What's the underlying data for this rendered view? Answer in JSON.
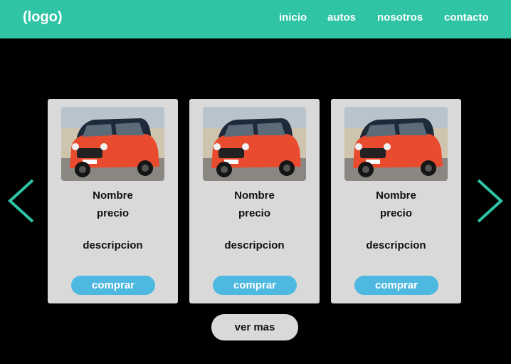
{
  "header": {
    "logo": "(logo)",
    "nav": [
      "inicio",
      "autos",
      "nosotros",
      "contacto"
    ]
  },
  "carousel": {
    "prev_icon": "chevron-left-icon",
    "next_icon": "chevron-right-icon",
    "cards": [
      {
        "image": "red-car-photo",
        "name": "Nombre",
        "price": "precio",
        "description": "descripcion",
        "button": "comprar"
      },
      {
        "image": "red-car-photo",
        "name": "Nombre",
        "price": "precio",
        "description": "descripcion",
        "button": "comprar"
      },
      {
        "image": "red-car-photo",
        "name": "Nombre",
        "price": "precio",
        "description": "descripcion",
        "button": "comprar"
      }
    ]
  },
  "more_button": "ver mas",
  "colors": {
    "header": "#2ec4a4",
    "background": "#000000",
    "card": "#d9d9d9",
    "buy_button": "#4db8e0",
    "arrow": "#2ec4a4"
  }
}
